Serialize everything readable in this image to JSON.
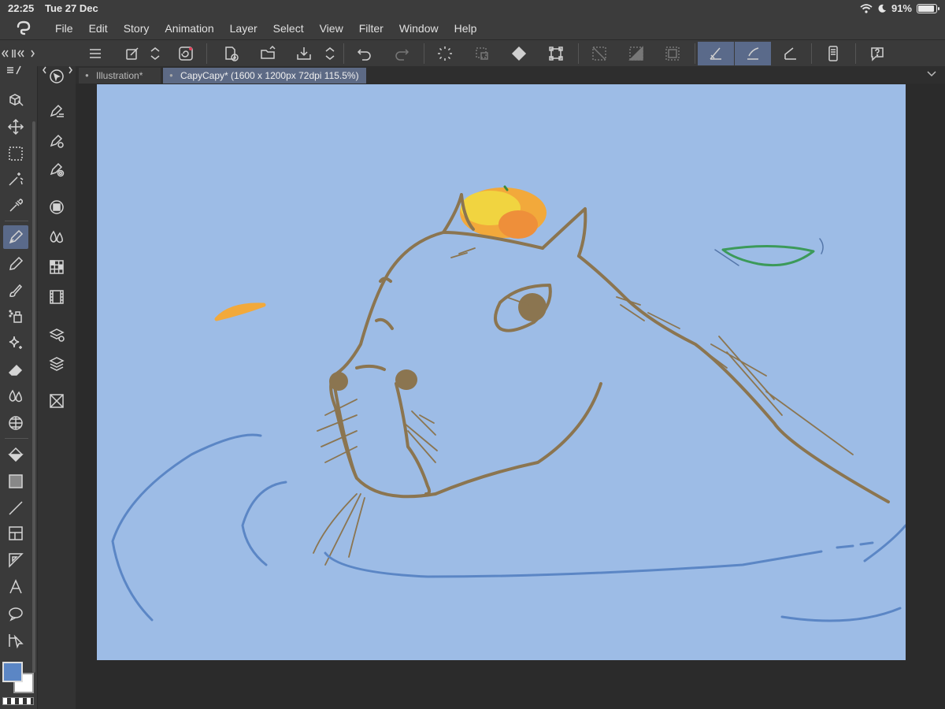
{
  "status": {
    "time": "22:25",
    "date": "Tue 27 Dec",
    "battery": "91%"
  },
  "menu": [
    "File",
    "Edit",
    "Story",
    "Animation",
    "Layer",
    "Select",
    "View",
    "Filter",
    "Window",
    "Help"
  ],
  "tabs": [
    {
      "label": "Illustration*",
      "active": false
    },
    {
      "label": "CapyCapy* (1600 x 1200px 72dpi 115.5%)",
      "active": true
    }
  ],
  "colors": {
    "main": "#5b86c5",
    "sub": "#ffffff",
    "canvas": "#9dbce6",
    "accent": "#5a6a8a"
  },
  "toolbar_icons": [
    "menu-icon",
    "edit-icon",
    "up-down-icon",
    "cloud-icon",
    "new-icon",
    "open-icon",
    "save-icon",
    "up-down-icon",
    "undo-icon",
    "redo-icon",
    "loading-icon",
    "selection-off-icon",
    "fill-icon",
    "transform-icon",
    "clear-selection-icon",
    "invert-selection-icon",
    "border-icon",
    "snap-ruler-icon",
    "snap-special-icon",
    "snap-grid-icon",
    "smartphone-icon",
    "help-icon"
  ],
  "left_tools": [
    "3d-icon",
    "move-icon",
    "marquee-icon",
    "magic-wand-icon",
    "eyedropper-icon",
    "pen-icon",
    "pencil-icon",
    "brush-icon",
    "airbrush-icon",
    "decoration-icon",
    "eraser-icon",
    "blend-icon",
    "figure-icon",
    "fill-icon",
    "gradient-icon",
    "line-icon",
    "frame-icon",
    "ruler-icon",
    "text-icon",
    "balloon-icon",
    "correct-line-icon"
  ]
}
